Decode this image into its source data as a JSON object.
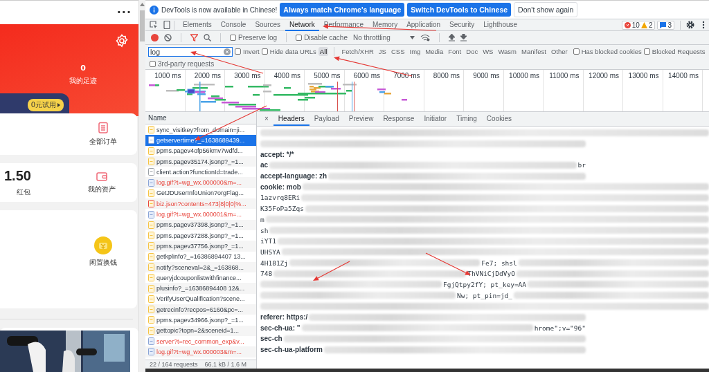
{
  "phone": {
    "menu": "···",
    "footprint": {
      "count": "0",
      "label": "我的足迹"
    },
    "trial_badge": "0元试用",
    "order_card": {
      "label": "全部订单"
    },
    "money_card": {
      "amount": "1.50",
      "amount_label": "红包",
      "assets_label": "我的资产"
    },
    "service_card": {
      "label": "闲置换钱"
    }
  },
  "devtools": {
    "infobar": {
      "message": "DevTools is now available in Chinese!",
      "buttons": [
        {
          "label": "Always match Chrome's language",
          "kind": "primary"
        },
        {
          "label": "Switch DevTools to Chinese",
          "kind": "primary"
        },
        {
          "label": "Don't show again",
          "kind": "plain"
        }
      ]
    },
    "tabs": [
      {
        "label": "Elements",
        "selected": false
      },
      {
        "label": "Console",
        "selected": false
      },
      {
        "label": "Sources",
        "selected": false
      },
      {
        "label": "Network",
        "selected": true
      },
      {
        "label": "Performance",
        "selected": false
      },
      {
        "label": "Memory",
        "selected": false
      },
      {
        "label": "Application",
        "selected": false
      },
      {
        "label": "Security",
        "selected": false
      },
      {
        "label": "Lighthouse",
        "selected": false
      }
    ],
    "counters": {
      "errors": "10",
      "warnings": "2",
      "messages": "3"
    },
    "toolbar": {
      "preserve_log": {
        "label": "Preserve log",
        "checked": false
      },
      "disable_cache": {
        "label": "Disable cache",
        "checked": false
      },
      "throttling": "No throttling"
    },
    "filter": {
      "value": "log",
      "invert": {
        "label": "Invert",
        "checked": false
      },
      "hide_data_urls": {
        "label": "Hide data URLs",
        "checked": false
      },
      "types": [
        {
          "label": "All",
          "selected": true
        },
        {
          "label": "Fetch/XHR",
          "selected": false
        },
        {
          "label": "JS",
          "selected": false
        },
        {
          "label": "CSS",
          "selected": false
        },
        {
          "label": "Img",
          "selected": false
        },
        {
          "label": "Media",
          "selected": false
        },
        {
          "label": "Font",
          "selected": false
        },
        {
          "label": "Doc",
          "selected": false
        },
        {
          "label": "WS",
          "selected": false
        },
        {
          "label": "Wasm",
          "selected": false
        },
        {
          "label": "Manifest",
          "selected": false
        },
        {
          "label": "Other",
          "selected": false
        }
      ],
      "blocked_cookies": {
        "label": "Has blocked cookies",
        "checked": false
      },
      "blocked_requests": {
        "label": "Blocked Requests",
        "checked": false
      },
      "third_party": {
        "label": "3rd-party requests",
        "checked": false
      }
    },
    "timeline_ticks": [
      "1000 ms",
      "2000 ms",
      "3000 ms",
      "4000 ms",
      "5000 ms",
      "6000 ms",
      "7000 ms",
      "8000 ms",
      "9000 ms",
      "10000 ms",
      "11000 ms",
      "12000 ms",
      "13000 ms",
      "14000 ms"
    ],
    "requests": {
      "column": "Name",
      "items": [
        {
          "name": "sync_visitkey?from_domain=ji...",
          "kind": "script",
          "failed": false,
          "selected": false
        },
        {
          "name": "getservertime?_=1638689439...",
          "failed": false,
          "selected": true
        },
        {
          "name": "ppms.pagev4ofp56kmv7wdfd...",
          "kind": "script",
          "failed": false,
          "selected": false
        },
        {
          "name": "ppms.pagev35174.jsonp?_=1...",
          "kind": "script",
          "failed": false,
          "selected": false
        },
        {
          "name": "client.action?functionId=trade...",
          "kind": "document",
          "failed": false,
          "selected": false
        },
        {
          "name": "log.gif?t=wg_wx.000000&m=...",
          "failed": true,
          "selected": false
        },
        {
          "name": "GetJDUserInfoUnion?orgFlag...",
          "kind": "script",
          "failed": false,
          "selected": false
        },
        {
          "name": "biz.json?contents=473|8|0|0|%...",
          "kind": "script",
          "failed": true,
          "selected": false
        },
        {
          "name": "log.gif?t=wg_wx.000001&m=...",
          "failed": true,
          "selected": false
        },
        {
          "name": "ppms.pagev37398.jsonp?_=1...",
          "kind": "script",
          "failed": false,
          "selected": false
        },
        {
          "name": "ppms.pagev37288.jsonp?_=1...",
          "kind": "script",
          "failed": false,
          "selected": false
        },
        {
          "name": "ppms.pagev37756.jsonp?_=1...",
          "kind": "script",
          "failed": false,
          "selected": false
        },
        {
          "name": "getkplinfo?_=16386894407 13...",
          "kind": "script",
          "failed": false,
          "selected": false
        },
        {
          "name": "notify?sceneval=2&_=163868...",
          "kind": "script",
          "failed": false,
          "selected": false
        },
        {
          "name": "queryjdcouponlistwithfinance...",
          "kind": "script",
          "failed": false,
          "selected": false
        },
        {
          "name": "plusinfo?_=16386894408 12&...",
          "kind": "script",
          "failed": false,
          "selected": false
        },
        {
          "name": "VerifyUserQualification?scene...",
          "kind": "script",
          "failed": false,
          "selected": false
        },
        {
          "name": "getrecinfo?recpos=6160&pc=...",
          "kind": "script",
          "failed": false,
          "selected": false
        },
        {
          "name": "ppms.pagev34966.jsonp?_=1...",
          "kind": "script",
          "failed": false,
          "selected": false
        },
        {
          "name": "gettopic?topn=2&sceneid=1...",
          "kind": "script",
          "failed": false,
          "selected": false
        },
        {
          "name": "server?t=rec_common_exp&v...",
          "failed": true,
          "selected": false
        },
        {
          "name": "log.gif?t=wg_wx.000003&m=...",
          "failed": true,
          "selected": false
        }
      ],
      "summary": [
        "22 / 164 requests",
        "66.1 kB / 1.6 M"
      ]
    },
    "detail_close": "×",
    "detail_tabs": [
      {
        "label": "Headers",
        "selected": true
      },
      {
        "label": "Payload",
        "selected": false
      },
      {
        "label": "Preview",
        "selected": false
      },
      {
        "label": "Response",
        "selected": false
      },
      {
        "label": "Initiator",
        "selected": false
      },
      {
        "label": "Timing",
        "selected": false
      },
      {
        "label": "Cookies",
        "selected": false
      }
    ],
    "header_lines": [
      {
        "kind": "full",
        "parts": [
          {
            "kind": "blur"
          }
        ]
      },
      {
        "kind": "short",
        "parts": [
          {
            "kind": "blur"
          }
        ]
      },
      {
        "kind": "short",
        "parts": [
          {
            "kind": "name",
            "text": "accept: */*"
          }
        ]
      },
      {
        "kind": "short",
        "parts": [
          {
            "kind": "name",
            "text": "ac"
          },
          {
            "kind": "blur"
          },
          {
            "kind": "value",
            "text": "br"
          }
        ]
      },
      {
        "kind": "short",
        "parts": [
          {
            "kind": "name",
            "text": "accept-language: zh"
          },
          {
            "kind": "blur"
          }
        ]
      },
      {
        "kind": "full",
        "parts": [
          {
            "kind": "name",
            "text": "cookie: mob"
          },
          {
            "kind": "blur"
          }
        ]
      },
      {
        "kind": "full",
        "parts": [
          {
            "kind": "value",
            "text": "1azvrq8ERi"
          },
          {
            "kind": "blur"
          }
        ]
      },
      {
        "kind": "full",
        "parts": [
          {
            "kind": "value",
            "text": "K35FoPa5Zqs"
          },
          {
            "kind": "blur"
          }
        ]
      },
      {
        "kind": "full",
        "parts": [
          {
            "kind": "value",
            "text": "m"
          },
          {
            "kind": "blur"
          }
        ]
      },
      {
        "kind": "full",
        "parts": [
          {
            "kind": "value",
            "text": "sh"
          },
          {
            "kind": "blur"
          }
        ]
      },
      {
        "kind": "full",
        "parts": [
          {
            "kind": "value",
            "text": "iYT1"
          },
          {
            "kind": "blur"
          }
        ]
      },
      {
        "kind": "full",
        "parts": [
          {
            "kind": "value",
            "text": "UHSYA"
          },
          {
            "kind": "blur"
          }
        ]
      },
      {
        "kind": "full",
        "parts": [
          {
            "kind": "value",
            "text": "4H181Zj"
          },
          {
            "kind": "blur"
          },
          {
            "kind": "value",
            "text": "Fe7; shsl"
          },
          {
            "kind": "blur"
          }
        ]
      },
      {
        "kind": "full",
        "parts": [
          {
            "kind": "value",
            "text": "748"
          },
          {
            "kind": "blur"
          },
          {
            "kind": "value",
            "text": "ThVNiCjDdVyO"
          },
          {
            "kind": "blur"
          }
        ]
      },
      {
        "kind": "full",
        "parts": [
          {
            "kind": "blur"
          },
          {
            "kind": "value",
            "text": "FgjQtpy2fY; pt_key=AA"
          },
          {
            "kind": "blur"
          }
        ]
      },
      {
        "kind": "full",
        "parts": [
          {
            "kind": "blur"
          },
          {
            "kind": "value",
            "text": "Nw; pt_pin=jd_"
          },
          {
            "kind": "blur"
          }
        ]
      },
      {
        "kind": "full",
        "parts": [
          {
            "kind": "blur"
          }
        ]
      },
      {
        "kind": "short",
        "parts": [
          {
            "kind": "name",
            "text": "referer: https:/"
          },
          {
            "kind": "blur"
          }
        ]
      },
      {
        "kind": "short",
        "parts": [
          {
            "kind": "name",
            "text": "sec-ch-ua: \""
          },
          {
            "kind": "blur"
          },
          {
            "kind": "value",
            "text": "hrome\";v=\"96\""
          }
        ]
      },
      {
        "kind": "short",
        "parts": [
          {
            "kind": "name",
            "text": "sec-ch"
          },
          {
            "kind": "blur"
          }
        ]
      },
      {
        "kind": "short",
        "parts": [
          {
            "kind": "name",
            "text": "sec-ch-ua-platform"
          },
          {
            "kind": "blur"
          }
        ]
      }
    ]
  }
}
